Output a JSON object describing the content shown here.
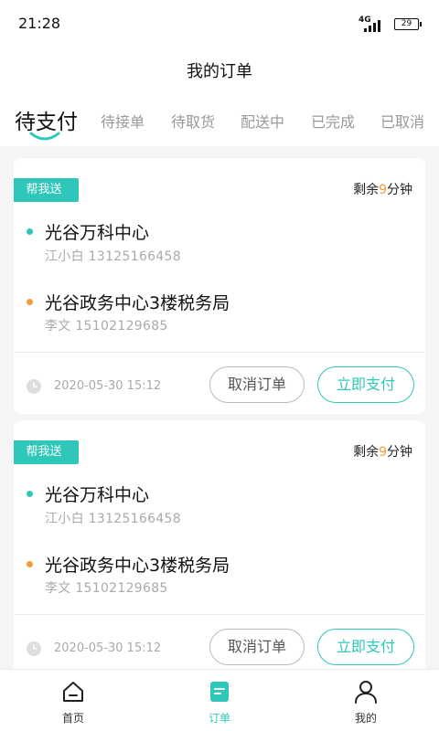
{
  "status_bar": {
    "time": "21:28",
    "network": "4G",
    "battery": "29"
  },
  "header": {
    "title": "我的订单"
  },
  "tabs": [
    {
      "label": "待支付",
      "active": true
    },
    {
      "label": "待接单"
    },
    {
      "label": "待取货"
    },
    {
      "label": "配送中"
    },
    {
      "label": "已完成"
    },
    {
      "label": "已取消"
    }
  ],
  "orders": [
    {
      "tag": "帮我送",
      "remain_prefix": "剩余",
      "remain_num": "9",
      "remain_suffix": "分钟",
      "pickup": {
        "name": "光谷万科中心",
        "contact": "江小白   13125166458"
      },
      "dropoff": {
        "name": "光谷政务中心3楼税务局",
        "contact": "李文   15102129685"
      },
      "time": "2020-05-30 15:12",
      "cancel_label": "取消订单",
      "pay_label": "立即支付"
    },
    {
      "tag": "帮我送",
      "remain_prefix": "剩余",
      "remain_num": "9",
      "remain_suffix": "分钟",
      "pickup": {
        "name": "光谷万科中心",
        "contact": "江小白   13125166458"
      },
      "dropoff": {
        "name": "光谷政务中心3楼税务局",
        "contact": "李文   15102129685"
      },
      "time": "2020-05-30 15:12",
      "cancel_label": "取消订单",
      "pay_label": "立即支付"
    }
  ],
  "bottom_nav": [
    {
      "label": "首页",
      "icon": "home-icon"
    },
    {
      "label": "订单",
      "icon": "order-icon",
      "active": true
    },
    {
      "label": "我的",
      "icon": "user-icon"
    }
  ],
  "colors": {
    "accent": "#2ec7b9",
    "orange": "#f59c3c"
  }
}
